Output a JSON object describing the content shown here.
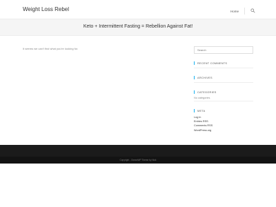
{
  "header": {
    "site_title": "Weight Loss Rebel",
    "nav": [
      {
        "label": "Home"
      }
    ],
    "search_icon": "search-icon"
  },
  "hero": {
    "title": "Keto + Intermittent Fasting = Rebellion Against Fat!"
  },
  "main": {
    "not_found_text": "It seems we can't find what you're looking for."
  },
  "sidebar": {
    "search": {
      "placeholder": "Search"
    },
    "widgets": [
      {
        "title": "Recent Comments"
      },
      {
        "title": "Archives"
      },
      {
        "title": "Categories",
        "note": "No categories"
      },
      {
        "title": "Meta",
        "links": [
          "Log in",
          "Entries RSS",
          "Comments RSS",
          "WordPress.org"
        ]
      }
    ]
  },
  "footer": {
    "copyright": "Copyright - OceanWP Theme by Nick"
  },
  "colors": {
    "accent": "#13aff0",
    "footer_bg": "#1b1b1b",
    "hero_bg": "#f5f5f5"
  }
}
